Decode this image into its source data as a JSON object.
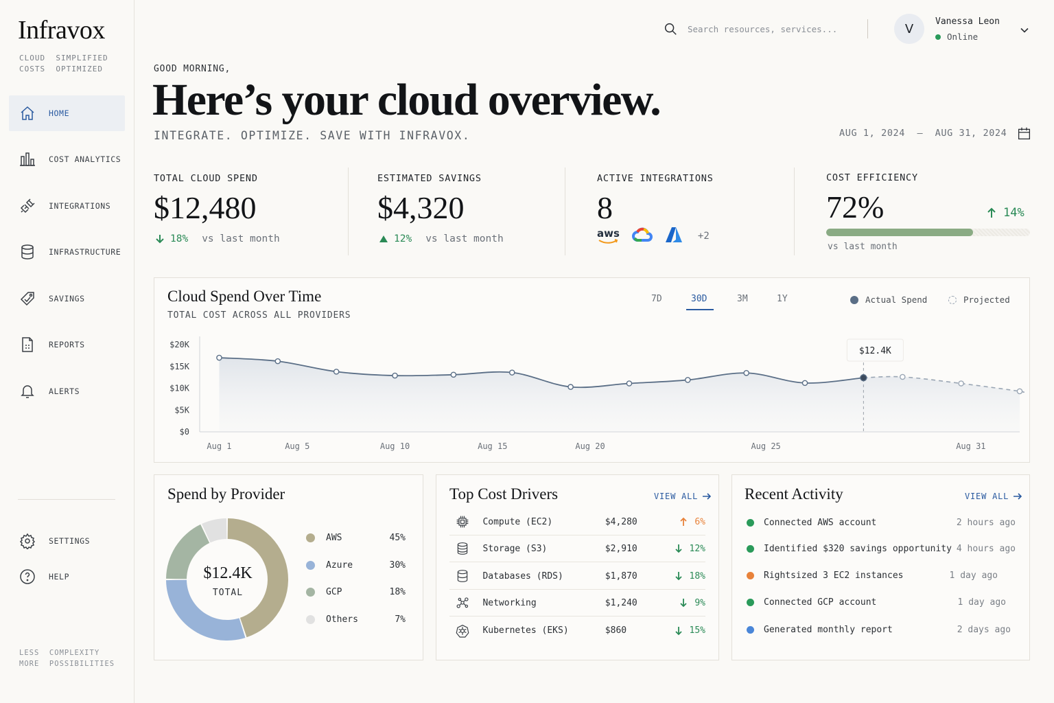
{
  "sidebar": {
    "logo": "Infravox",
    "tagline": "CLOUD  SIMPLIFIED\nCOSTS  OPTIMIZED",
    "items": [
      {
        "label": "HOME",
        "icon": "home-icon"
      },
      {
        "label": "COST ANALYTICS",
        "icon": "bar-chart-icon"
      },
      {
        "label": "INTEGRATIONS",
        "icon": "plug-icon"
      },
      {
        "label": "INFRASTRUCTURE",
        "icon": "database-icon"
      },
      {
        "label": "SAVINGS",
        "icon": "tag-check-icon"
      },
      {
        "label": "REPORTS",
        "icon": "report-icon"
      },
      {
        "label": "ALERTS",
        "icon": "bell-icon"
      }
    ],
    "bottom_items": [
      {
        "label": "SETTINGS",
        "icon": "gear-icon"
      },
      {
        "label": "HELP",
        "icon": "help-icon"
      }
    ],
    "footer": "LESS  COMPLEXITY\nMORE  POSSIBILITIES"
  },
  "topbar": {
    "search_placeholder": "Search resources, services...",
    "user_initial": "V",
    "user_name": "Vanessa Leon",
    "user_status": "Online"
  },
  "hero": {
    "greeting": "GOOD MORNING,",
    "title": "Here’s your cloud overview.",
    "subtitle": "INTEGRATE. OPTIMIZE. SAVE WITH INFRAVOX.",
    "date_range": "AUG 1, 2024  —  AUG 31, 2024"
  },
  "kpis": {
    "spend": {
      "label": "TOTAL CLOUD SPEND",
      "value": "$12,480",
      "delta": "18%",
      "vs": "vs last month"
    },
    "savings": {
      "label": "ESTIMATED SAVINGS",
      "value": "$4,320",
      "delta": "12%",
      "vs": "vs last month"
    },
    "integrations": {
      "label": "ACTIVE INTEGRATIONS",
      "value": "8",
      "aws_text": "aws",
      "more": "+2"
    },
    "efficiency": {
      "label": "COST EFFICIENCY",
      "value": "72%",
      "delta": "14%",
      "vs": "vs last month",
      "progress": 0.72
    }
  },
  "spend_chart": {
    "title": "Cloud Spend Over Time",
    "subtitle": "TOTAL COST ACROSS ALL PROVIDERS",
    "ranges": [
      "7D",
      "30D",
      "3M",
      "1Y"
    ],
    "active_range": "30D",
    "legend": {
      "actual": "Actual Spend",
      "projected": "Projected"
    },
    "tooltip": "$12.4K"
  },
  "chart_data": {
    "type": "line",
    "x_ticks": [
      "Aug 1",
      "Aug 5",
      "Aug 10",
      "Aug 15",
      "Aug 20",
      "Aug 25",
      "Aug 31"
    ],
    "y_ticks": [
      "$20K",
      "$15K",
      "$10K",
      "$5K",
      "$0"
    ],
    "ylim": [
      0,
      20000
    ],
    "series": [
      {
        "name": "Actual Spend",
        "points": [
          [
            1,
            17000
          ],
          [
            4,
            16200
          ],
          [
            7,
            13800
          ],
          [
            10,
            12900
          ],
          [
            13,
            13100
          ],
          [
            16,
            13600
          ],
          [
            19,
            10300
          ],
          [
            22,
            11100
          ],
          [
            25,
            11900
          ],
          [
            28,
            13500
          ],
          [
            31,
            11200
          ],
          [
            34,
            12400
          ]
        ]
      },
      {
        "name": "Projected",
        "points": [
          [
            34,
            12400
          ],
          [
            36,
            12600
          ],
          [
            39,
            11100
          ],
          [
            42,
            9300
          ]
        ]
      }
    ],
    "x_tick_positions": [
      1,
      5,
      10,
      15,
      20,
      25,
      31
    ],
    "colors": {
      "actual": "#5a6e86",
      "projected": "#9aa6b4"
    }
  },
  "provider": {
    "title": "Spend by Provider",
    "center_value": "$12.4K",
    "center_label": "TOTAL",
    "items": [
      {
        "name": "AWS",
        "pct": "45%",
        "value": 45,
        "color": "#b4ad8e"
      },
      {
        "name": "Azure",
        "pct": "30%",
        "value": 30,
        "color": "#98b3d8"
      },
      {
        "name": "GCP",
        "pct": "18%",
        "value": 18,
        "color": "#a4b5a3"
      },
      {
        "name": "Others",
        "pct": "7%",
        "value": 7,
        "color": "#e1e1e1"
      }
    ]
  },
  "drivers": {
    "title": "Top Cost Drivers",
    "view_all": "VIEW ALL",
    "rows": [
      {
        "name": "Compute (EC2)",
        "cost": "$4,280",
        "delta": "6%",
        "dir": "up",
        "icon": "chip-icon"
      },
      {
        "name": "Storage (S3)",
        "cost": "$2,910",
        "delta": "12%",
        "dir": "down",
        "icon": "storage-icon"
      },
      {
        "name": "Databases (RDS)",
        "cost": "$1,870",
        "delta": "18%",
        "dir": "down",
        "icon": "database-icon"
      },
      {
        "name": "Networking",
        "cost": "$1,240",
        "delta": "9%",
        "dir": "down",
        "icon": "network-icon"
      },
      {
        "name": "Kubernetes (EKS)",
        "cost": "$860",
        "delta": "15%",
        "dir": "down",
        "icon": "kubernetes-icon"
      }
    ]
  },
  "activity": {
    "title": "Recent Activity",
    "view_all": "VIEW ALL",
    "rows": [
      {
        "text": "Connected AWS account",
        "when": "2 hours ago",
        "color": "#2a9a5a"
      },
      {
        "text": "Identified $320 savings opportunity",
        "when": "4 hours ago",
        "color": "#2a9a5a"
      },
      {
        "text": "Rightsized 3 EC2 instances",
        "when": "1 day ago",
        "color": "#e8823a"
      },
      {
        "text": "Connected GCP account",
        "when": "1 day ago",
        "color": "#2a9a5a"
      },
      {
        "text": "Generated monthly report",
        "when": "2 days ago",
        "color": "#4a86d8"
      }
    ]
  }
}
